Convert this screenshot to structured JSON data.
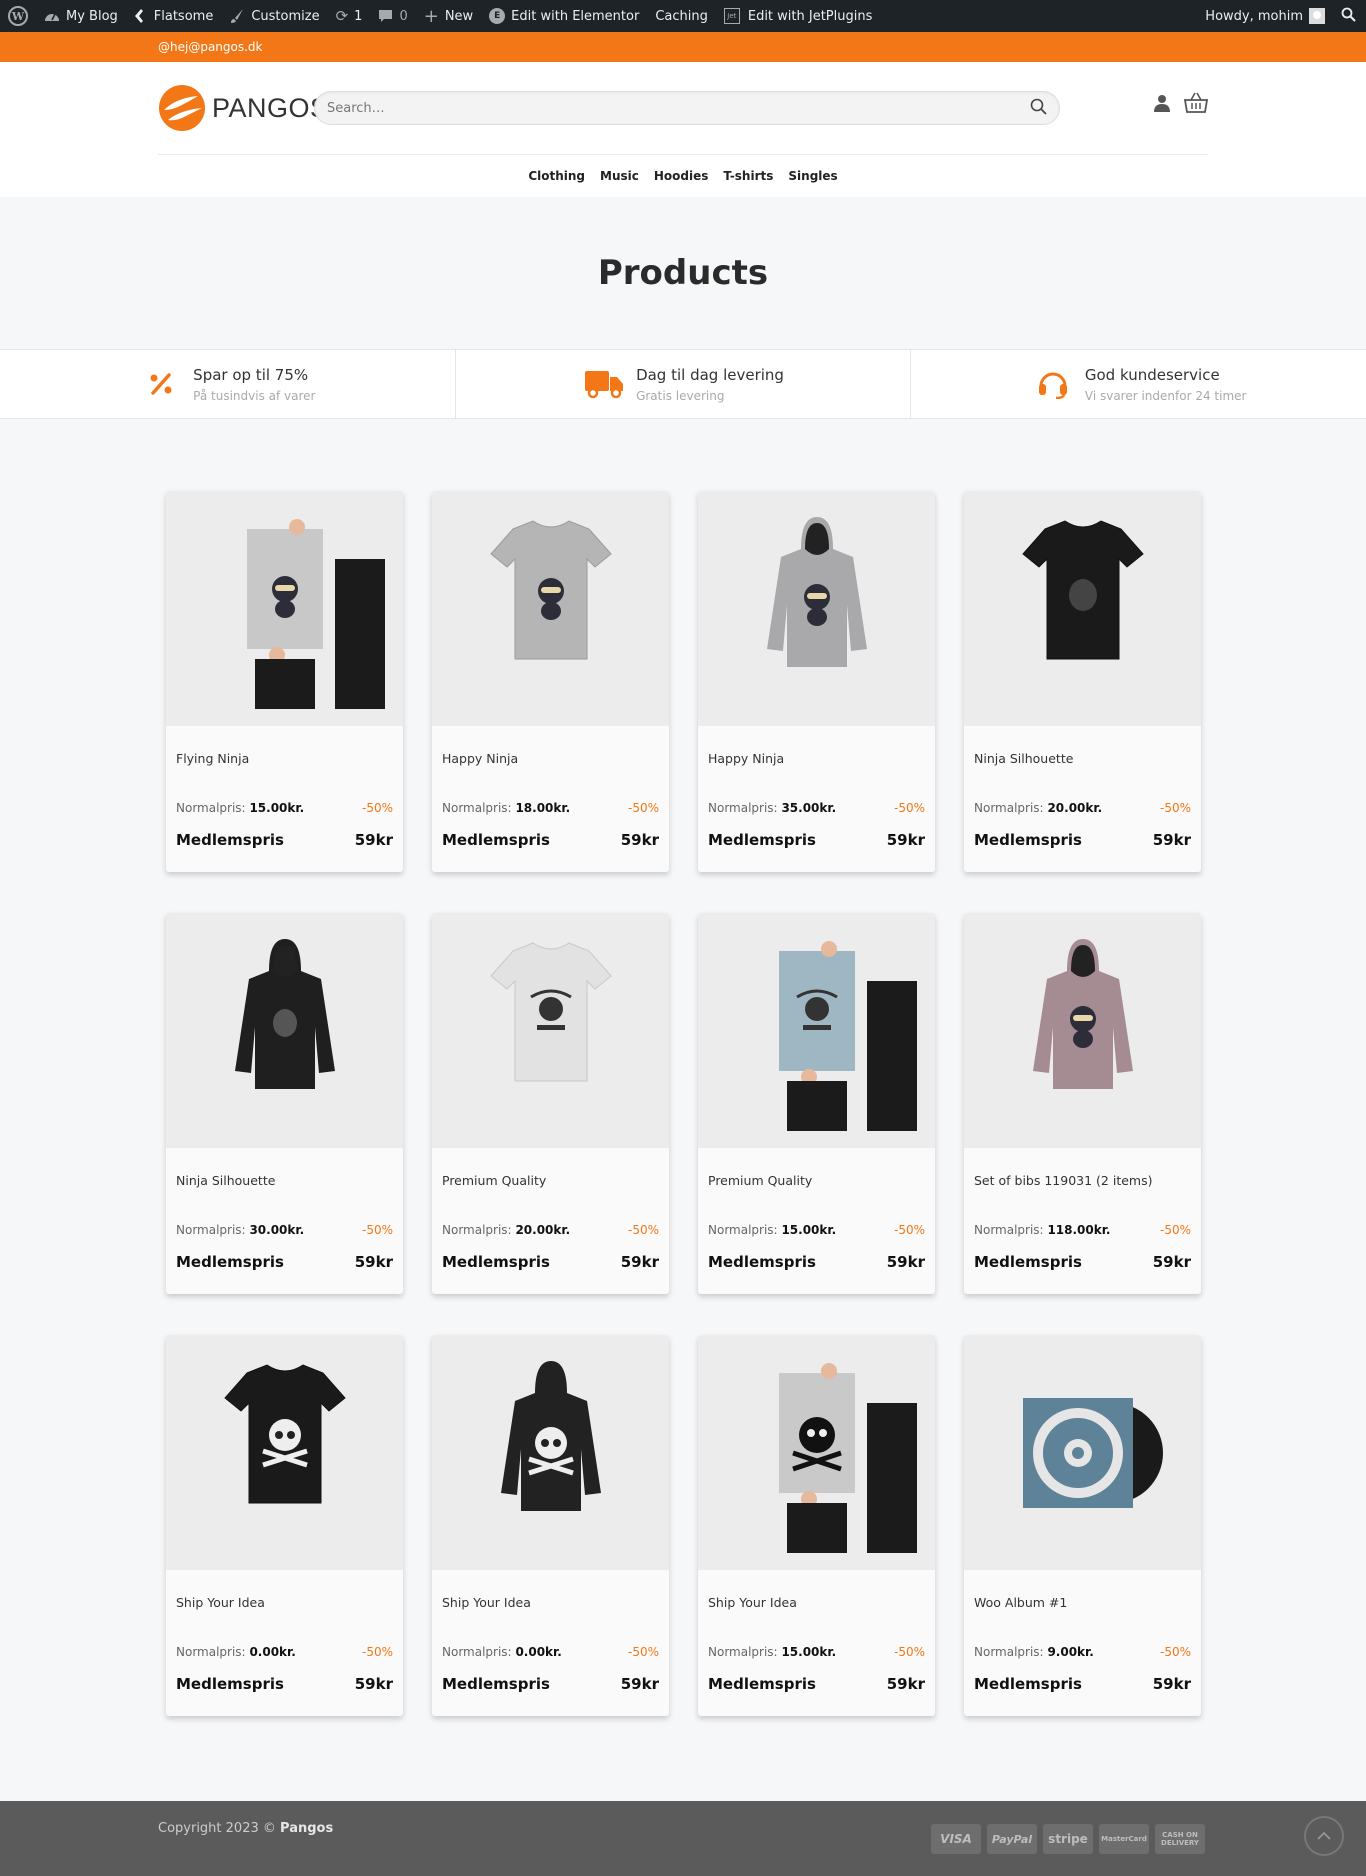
{
  "adminbar": {
    "my_blog": "My Blog",
    "flatsome": "Flatsome",
    "customize": "Customize",
    "updates": "1",
    "comments": "0",
    "new": "New",
    "elementor": "Edit with Elementor",
    "caching": "Caching",
    "jet": "Edit with JetPlugins",
    "howdy": "Howdy, mohim"
  },
  "topbar": {
    "email": "@hej@pangos.dk"
  },
  "header": {
    "logo_text": "PANGOS",
    "search_placeholder": "Search…"
  },
  "nav": [
    "Clothing",
    "Music",
    "Hoodies",
    "T-shirts",
    "Singles"
  ],
  "page_title": "Products",
  "usp": [
    {
      "title": "Spar op til 75%",
      "sub": "På tusindvis af varer",
      "icon": "percent-icon"
    },
    {
      "title": "Dag til dag levering",
      "sub": "Gratis levering",
      "icon": "truck-icon"
    },
    {
      "title": "God kundeservice",
      "sub": "Vi svarer indenfor 24 timer",
      "icon": "headset-icon"
    }
  ],
  "product_labels": {
    "normal": "Normalpris:",
    "discount": "-50%",
    "member": "Medlemspris",
    "member_price": "59kr"
  },
  "products": [
    {
      "name": "Flying Ninja",
      "price": "15.00kr.",
      "image": "poster-ninja"
    },
    {
      "name": "Happy Ninja",
      "price": "18.00kr.",
      "image": "tshirt-grey-ninja"
    },
    {
      "name": "Happy Ninja",
      "price": "35.00kr.",
      "image": "hoodie-grey-ninja"
    },
    {
      "name": "Ninja Silhouette",
      "price": "20.00kr.",
      "image": "tshirt-black-ninja"
    },
    {
      "name": "Ninja Silhouette",
      "price": "30.00kr.",
      "image": "hoodie-black-ninja"
    },
    {
      "name": "Premium Quality",
      "price": "20.00kr.",
      "image": "tshirt-white-woo"
    },
    {
      "name": "Premium Quality",
      "price": "15.00kr.",
      "image": "poster-blue-woo"
    },
    {
      "name": "Set of bibs 119031 (2 items)",
      "price": "118.00kr.",
      "image": "hoodie-mauve-ninja"
    },
    {
      "name": "Ship Your Idea",
      "price": "0.00kr.",
      "image": "tshirt-black-skull"
    },
    {
      "name": "Ship Your Idea",
      "price": "0.00kr.",
      "image": "hoodie-black-skull"
    },
    {
      "name": "Ship Your Idea",
      "price": "15.00kr.",
      "image": "poster-skull"
    },
    {
      "name": "Woo Album #1",
      "price": "9.00kr.",
      "image": "vinyl-album"
    }
  ],
  "footer": {
    "copyright": "Copyright 2023 ©",
    "brand": "Pangos",
    "payments": [
      "VISA",
      "PayPal",
      "stripe",
      "MasterCard",
      "CASH ON DELIVERY"
    ]
  },
  "colors": {
    "accent": "#f37716",
    "adminbar": "#1d2327",
    "footer": "#5b5b5b"
  }
}
